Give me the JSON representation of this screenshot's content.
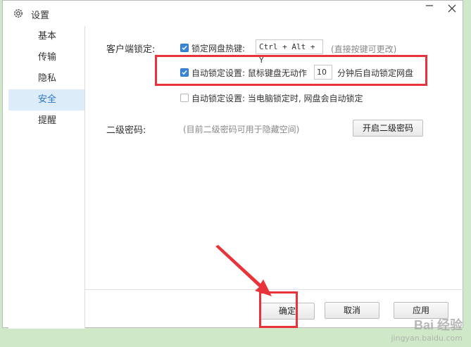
{
  "window": {
    "title": "设置"
  },
  "sidebar": {
    "items": [
      {
        "label": "基本",
        "active": false
      },
      {
        "label": "传输",
        "active": false
      },
      {
        "label": "隐私",
        "active": false
      },
      {
        "label": "安全",
        "active": true
      },
      {
        "label": "提醒",
        "active": false
      }
    ]
  },
  "client_lock": {
    "section_label": "客户端锁定:",
    "hotkey": {
      "checked": true,
      "label": "锁定网盘热键:",
      "value": "Ctrl + Alt + Y",
      "hint": "(直接按键可更改)"
    },
    "idle_lock": {
      "checked": true,
      "label": "自动锁定设置: 鼠标键盘无动作",
      "minutes": "10",
      "suffix": "分钟后自动锁定网盘"
    },
    "pc_lock": {
      "checked": false,
      "label": "自动锁定设置: 当电脑锁定时, 网盘会自动锁定"
    }
  },
  "second_password": {
    "label": "二级密码:",
    "hint": "(目前二级密码可用于隐藏空间)",
    "button": "开启二级密码"
  },
  "footer": {
    "ok": "确定",
    "cancel": "取消",
    "apply": "应用"
  },
  "watermark": {
    "main": "Bai 经验",
    "sub": "jingyan.baidu.com"
  },
  "colors": {
    "accent": "#3a86d6",
    "highlight": "#e8333a",
    "sidebar_active_bg": "#dcecf9"
  }
}
